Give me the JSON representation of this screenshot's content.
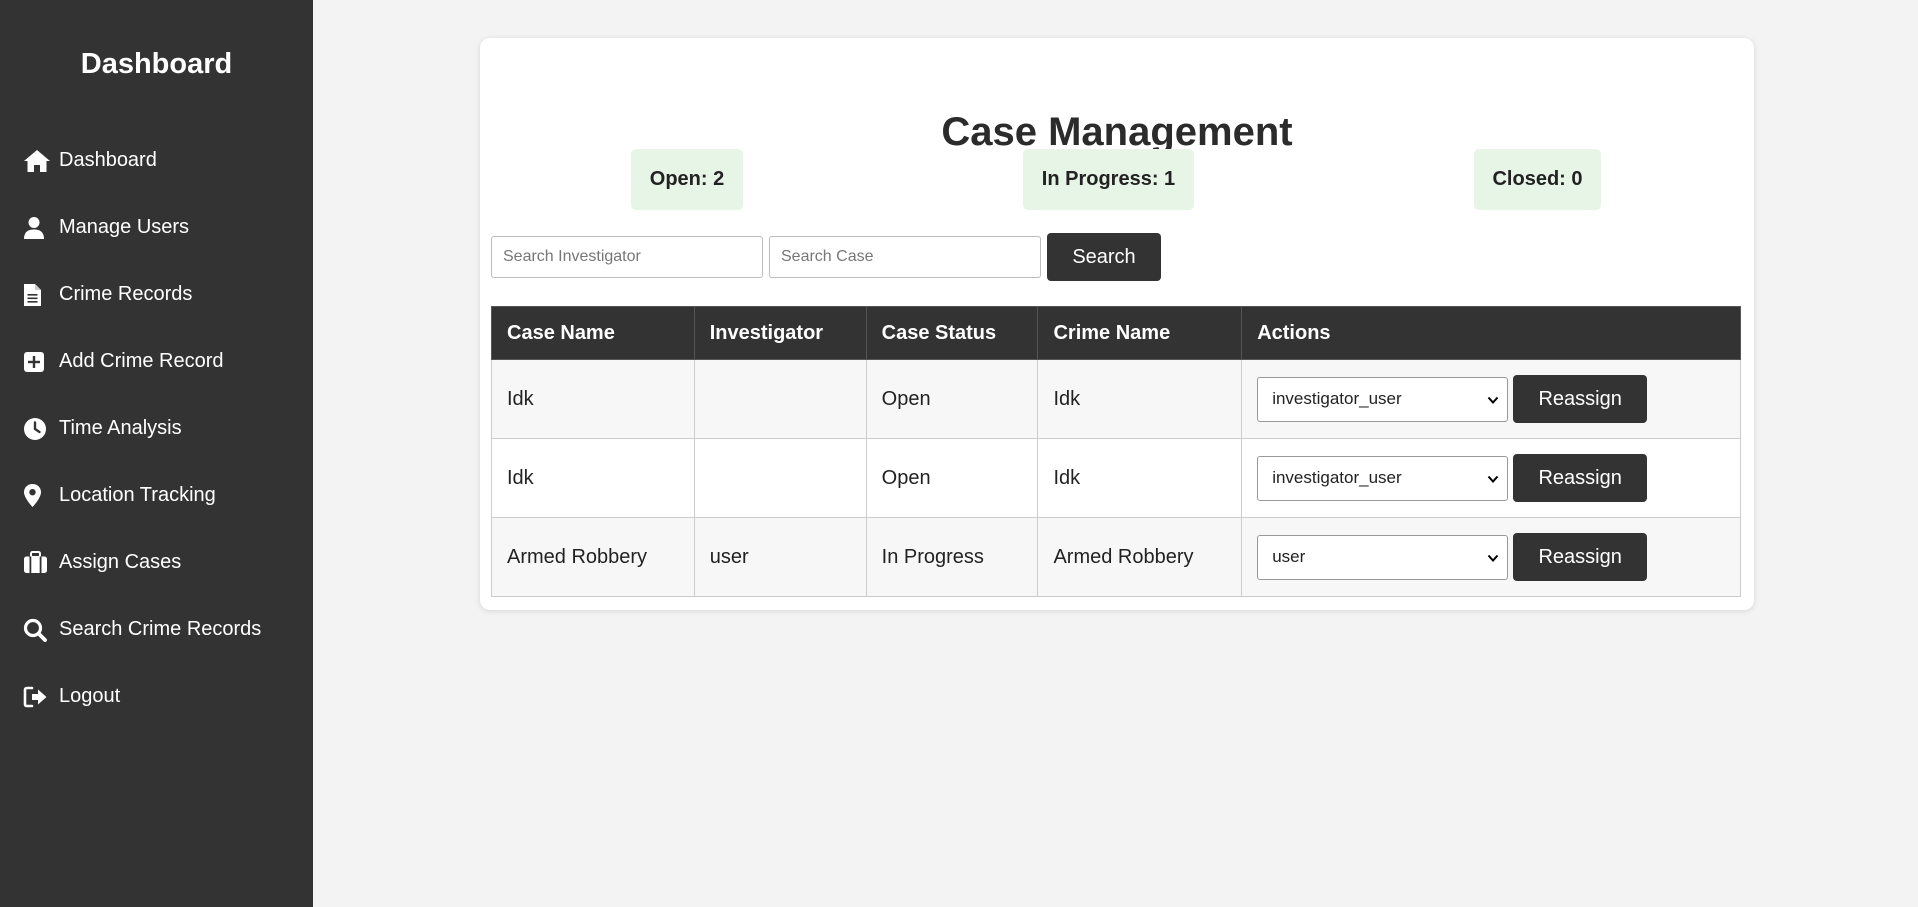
{
  "sidebar": {
    "title": "Dashboard",
    "items": [
      {
        "label": "Dashboard",
        "icon": "home-icon"
      },
      {
        "label": "Manage Users",
        "icon": "user-icon"
      },
      {
        "label": "Crime Records",
        "icon": "document-icon"
      },
      {
        "label": "Add Crime Record",
        "icon": "plus-square-icon"
      },
      {
        "label": "Time Analysis",
        "icon": "clock-icon"
      },
      {
        "label": "Location Tracking",
        "icon": "location-pin-icon"
      },
      {
        "label": "Assign Cases",
        "icon": "briefcase-icon"
      },
      {
        "label": "Search Crime Records",
        "icon": "search-icon"
      },
      {
        "label": "Logout",
        "icon": "logout-icon"
      }
    ]
  },
  "main": {
    "title": "Case Management",
    "stats": {
      "open": "Open: 2",
      "in_progress": "In Progress: 1",
      "closed": "Closed: 0"
    },
    "search": {
      "investigator_placeholder": "Search Investigator",
      "investigator_value": "",
      "case_placeholder": "Search Case",
      "case_value": "",
      "button_label": "Search"
    },
    "table": {
      "headers": [
        "Case Name",
        "Investigator",
        "Case Status",
        "Crime Name",
        "Actions"
      ],
      "rows": [
        {
          "case_name": "Idk",
          "investigator": "",
          "status": "Open",
          "crime_name": "Idk",
          "selected": "investigator_user",
          "action_label": "Reassign"
        },
        {
          "case_name": "Idk",
          "investigator": "",
          "status": "Open",
          "crime_name": "Idk",
          "selected": "investigator_user",
          "action_label": "Reassign"
        },
        {
          "case_name": "Armed Robbery",
          "investigator": "user",
          "status": "In Progress",
          "crime_name": "Armed Robbery",
          "selected": "user",
          "action_label": "Reassign"
        }
      ]
    }
  },
  "colors": {
    "sidebar_bg": "#333333",
    "page_bg": "#f3f3f3",
    "stat_bg": "#e7f5e7",
    "button_bg": "#333333"
  }
}
